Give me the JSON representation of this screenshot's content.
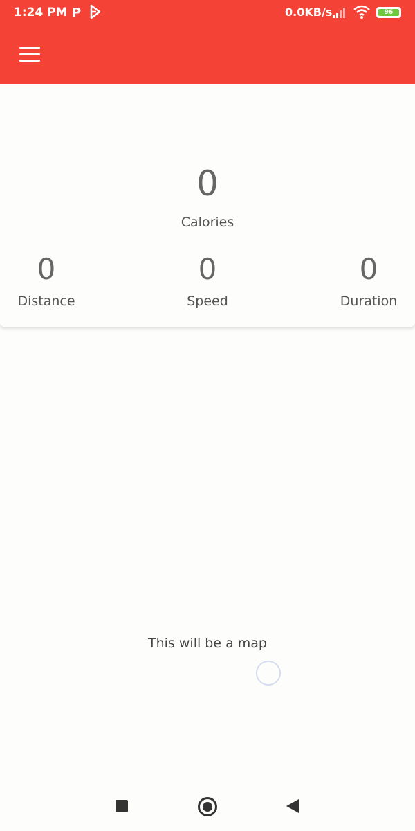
{
  "status_bar": {
    "time": "1:24 PM",
    "notification_p": "P",
    "network_speed": "0.0KB/s",
    "battery_level": "96",
    "icons": [
      "play-store-icon",
      "signal-icon",
      "wifi-icon",
      "battery-icon"
    ]
  },
  "app_bar": {
    "background_color": "#f44336",
    "menu_icon": "hamburger-menu-icon"
  },
  "stats": {
    "calories": {
      "value": "0",
      "label": "Calories"
    },
    "distance": {
      "value": "0",
      "label": "Distance"
    },
    "speed": {
      "value": "0",
      "label": "Speed"
    },
    "duration": {
      "value": "0",
      "label": "Duration"
    }
  },
  "map": {
    "placeholder_text": "This will be a map"
  },
  "nav_bar": {
    "icons": [
      "recent-apps-icon",
      "home-icon",
      "back-icon"
    ]
  }
}
